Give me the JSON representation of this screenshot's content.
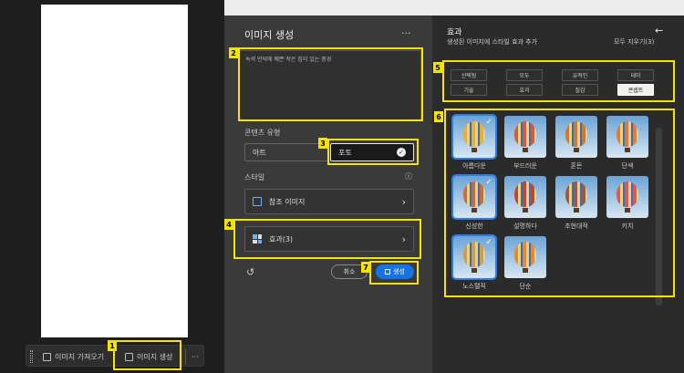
{
  "taskbar": {
    "import_label": "이미지 가져오기",
    "generate_label": "이미지 생성",
    "more": "···"
  },
  "left": {
    "title": "이미지 생성",
    "more": "···",
    "prompt_text": "녹색 언덕에 예쁜 작은 집이 있는 풍경",
    "content_type_label": "콘텐츠 유형",
    "content_art": "아트",
    "content_photo": "포토",
    "style_label": "스타일",
    "style_info": "ⓘ",
    "reference_label": "참조 이미지",
    "effects_label": "효과(3)",
    "cancel_label": "취소",
    "generate_label": "생성"
  },
  "right": {
    "title": "효과",
    "subtitle": "생성된 이미지에 스타일 효과 추가",
    "back": "←",
    "clear_all": "모두 지우기(3)",
    "tags": [
      "선택됨",
      "모두",
      "유적인",
      "테마",
      "기술",
      "효과",
      "질감",
      "콘셉트"
    ],
    "selected_tag": "콘셉트",
    "tiles": [
      {
        "label": "아름다운",
        "selected": true,
        "color": "#e0b040"
      },
      {
        "label": "부드러운",
        "selected": false,
        "color": "#d45a3c"
      },
      {
        "label": "혼돈",
        "selected": false,
        "color": "#c97a3a"
      },
      {
        "label": "단색",
        "selected": false,
        "color": "#d87c4a"
      },
      {
        "label": "신성한",
        "selected": true,
        "color": "#c86c40"
      },
      {
        "label": "설명하다",
        "selected": false,
        "color": "#b94a36"
      },
      {
        "label": "초현대적",
        "selected": false,
        "color": "#9a5a4a"
      },
      {
        "label": "키치",
        "selected": false,
        "color": "#d85a5a"
      },
      {
        "label": "노스탤직",
        "selected": true,
        "color": "#c8a050"
      },
      {
        "label": "단순",
        "selected": false,
        "color": "#e08a3a"
      }
    ]
  },
  "callouts": [
    "1",
    "2",
    "3",
    "4",
    "5",
    "6",
    "7"
  ]
}
